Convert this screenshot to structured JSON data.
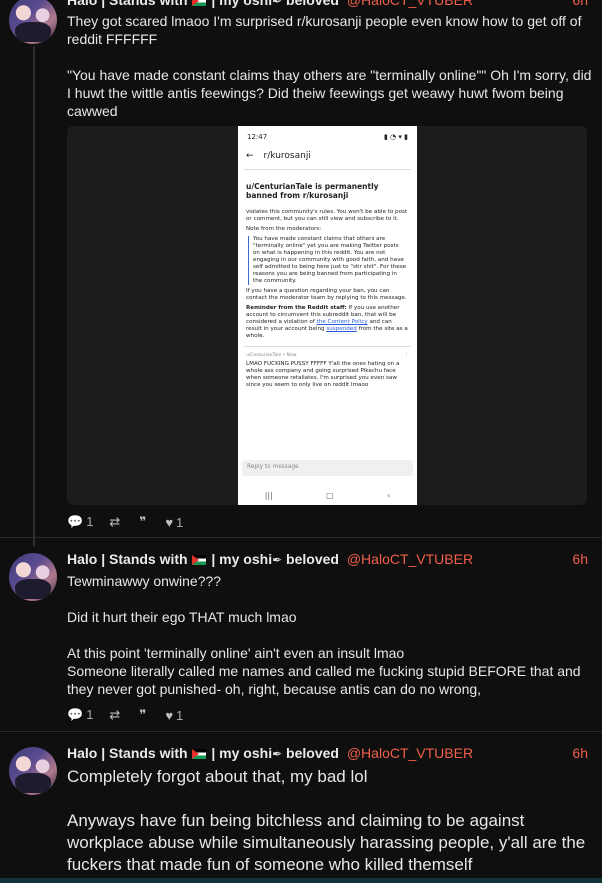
{
  "posts": [
    {
      "author": "Halo | Stands with",
      "author_suffix": "| my oshi",
      "author_tail": "beloved",
      "handle": "@HaloCT_VTUBER",
      "time": "6h",
      "paragraphs": [
        "They got scared lmaoo I'm surprised r/kurosanji people even know how to get off of reddit FFFFFF",
        "\"You have made constant claims thay others are \"terminally online\"\" Oh I'm sorry, did I huwt the wittle antis feewings? Did theiw feewings get weawy huwt fwom being cawwed"
      ],
      "replies": "1",
      "likes": "1"
    },
    {
      "author": "Halo | Stands with",
      "author_suffix": "| my oshi",
      "author_tail": "beloved",
      "handle": "@HaloCT_VTUBER",
      "time": "6h",
      "paragraphs": [
        "Tewminawwy onwine???",
        "Did it hurt their ego THAT much lmao",
        "At this point 'terminally online' ain't even an insult lmao",
        "Someone literally called me names and called me fucking stupid BEFORE that and they never got punished- oh, right, because antis can do no wrong,"
      ],
      "replies": "1",
      "likes": "1"
    },
    {
      "author": "Halo | Stands with",
      "author_suffix": "| my oshi",
      "author_tail": "beloved",
      "handle": "@HaloCT_VTUBER",
      "time": "6h",
      "paragraphs": [
        "Completely forgot about that, my bad lol",
        "Anyways have fun being bitchless and claiming to be against workplace abuse while simultaneously harassing people, y'all are the fuckers that made fun of someone who killed themself"
      ]
    }
  ],
  "screenshot": {
    "status_time": "12:47",
    "nav_title": "r/kurosanji",
    "ban_title": "u/CenturianTale is permanently banned from r/kurosanji",
    "p1": "violates this community's rules. You won't be able to post or comment, but you can still view and subscribe to it.",
    "p2": "Note from the moderators:",
    "quote": "You have made constant claims that others are \"terminally online\" yet you are making Twitter posts on what is happening in this reddit. You are not engaging in our community with good faith, and have self admitted to being here just to \"stir shit\". For these reasons you are being banned from participating in the community.",
    "p3": "If you have a question regarding your ban, you can contact the moderator team by replying to this message.",
    "p4_bold": "Reminder from the Reddit staff:",
    "p4_a": " If you use another account to circumvent this subreddit ban, that will be considered a violation of ",
    "p4_link1": "the Content Policy",
    "p4_b": " and can result in your account being ",
    "p4_link2": "suspended",
    "p4_c": " from the site as a whole.",
    "msg_meta": "u/CenturianTale • Now",
    "msg": "LMAO FUCKING PUSSY FFFFF Y'all the ones hating on a whole ass company and going surprised Pikachu face when someone retaliates. I'm surprised you even saw since you seem to only live on reddit lmaoo",
    "reply_placeholder": "Reply to message"
  }
}
